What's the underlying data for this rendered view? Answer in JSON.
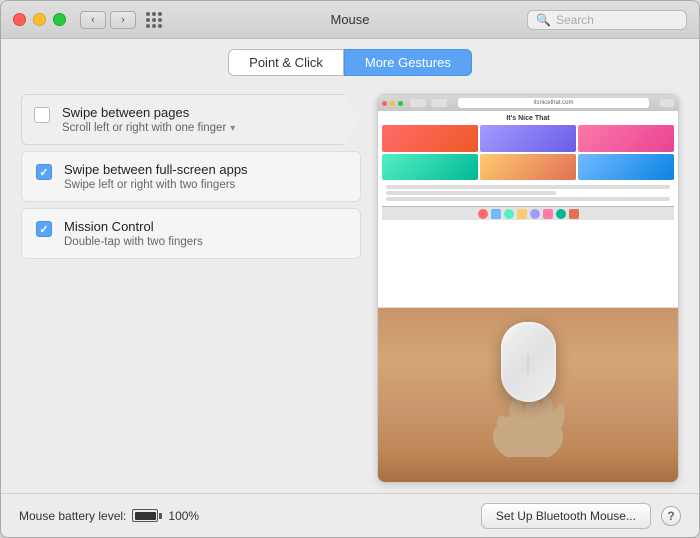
{
  "window": {
    "title": "Mouse",
    "search_placeholder": "Search"
  },
  "tabs": {
    "left": "Point & Click",
    "right": "More Gestures"
  },
  "settings": {
    "item1": {
      "title": "Swipe between pages",
      "subtitle": "Scroll left or right with one finger",
      "checked": false,
      "has_dropdown": true
    },
    "item2": {
      "title": "Swipe between full-screen apps",
      "subtitle": "Swipe left or right with two fingers",
      "checked": true
    },
    "item3": {
      "title": "Mission Control",
      "subtitle": "Double-tap with two fingers",
      "checked": true
    }
  },
  "footer": {
    "battery_label": "Mouse battery level:",
    "battery_percent": "100%",
    "setup_button": "Set Up Bluetooth Mouse...",
    "help_button": "?"
  },
  "browser_preview": {
    "site_name": "It's Nice That",
    "url": "itsnicethat.com"
  }
}
